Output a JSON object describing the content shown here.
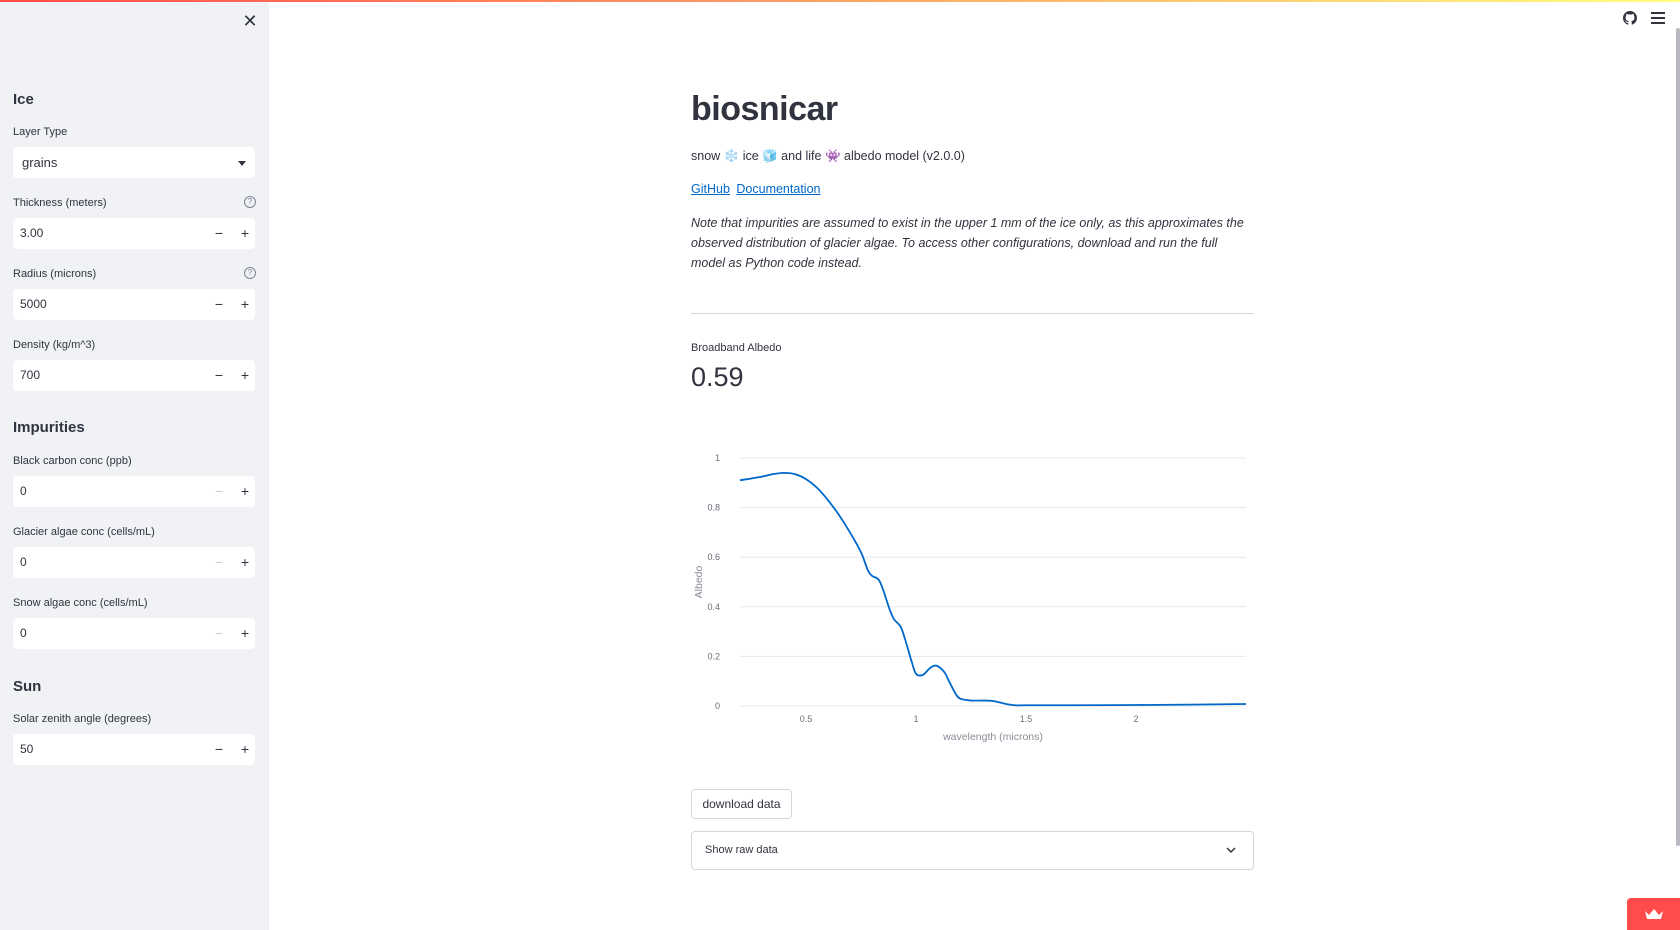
{
  "sidebar": {
    "close_icon": "close-icon",
    "ice_section": "Ice",
    "layer_type_label": "Layer Type",
    "layer_type_value": "grains",
    "thickness_label": "Thickness (meters)",
    "thickness_value": "3.00",
    "radius_label": "Radius (microns)",
    "radius_value": "5000",
    "density_label": "Density (kg/m^3)",
    "density_value": "700",
    "impurities_section": "Impurities",
    "black_carbon_label": "Black carbon conc (ppb)",
    "black_carbon_value": "0",
    "glacier_algae_label": "Glacier algae conc (cells/mL)",
    "glacier_algae_value": "0",
    "snow_algae_label": "Snow algae conc (cells/mL)",
    "snow_algae_value": "0",
    "sun_section": "Sun",
    "zenith_label": "Solar zenith angle (degrees)",
    "zenith_value": "50",
    "help_glyph": "?",
    "minus_glyph": "−",
    "plus_glyph": "+"
  },
  "header": {
    "github_icon": "github-icon",
    "menu_icon": "hamburger-menu-icon"
  },
  "main": {
    "title": "biosnicar",
    "subtitle": "snow ❄️ ice 🧊 and life 👾 albedo model (v2.0.0)",
    "link_github": "GitHub",
    "link_docs": "Documentation",
    "note": "Note that impurities are assumed to exist in the upper 1 mm of the ice only, as this approximates the observed distribution of glacier algae. To access other configurations, download and run the full model as Python code instead.",
    "metric_label": "Broadband Albedo",
    "metric_value": "0.59",
    "download_label": "download data",
    "expander_label": "Show raw data"
  },
  "chart_data": {
    "type": "line",
    "xlabel": "wavelength (microns)",
    "ylabel": "Albedo",
    "xlim": [
      0.2,
      2.5
    ],
    "ylim": [
      0,
      1
    ],
    "x_ticks": [
      0.5,
      1,
      1.5,
      2
    ],
    "x_tick_labels": [
      "0.5",
      "1",
      "1.5",
      "2"
    ],
    "y_ticks": [
      0,
      0.2,
      0.4,
      0.6,
      0.8,
      1
    ],
    "y_tick_labels": [
      "0",
      "0.2",
      "0.4",
      "0.6",
      "0.8",
      "1"
    ],
    "grid": true,
    "line_color": "#0068c9",
    "series": [
      {
        "x": [
          0.2,
          0.3,
          0.35,
          0.4,
          0.45,
          0.5,
          0.55,
          0.6,
          0.65,
          0.7,
          0.75,
          0.78,
          0.8,
          0.83,
          0.85,
          0.88,
          0.9,
          0.93,
          0.95,
          0.98,
          1.0,
          1.03,
          1.06,
          1.08,
          1.1,
          1.13,
          1.15,
          1.18,
          1.2,
          1.25,
          1.3,
          1.35,
          1.4,
          1.45,
          1.5,
          1.7,
          2.0,
          2.3,
          2.5
        ],
        "y": [
          0.91,
          0.925,
          0.935,
          0.94,
          0.935,
          0.915,
          0.88,
          0.83,
          0.77,
          0.7,
          0.62,
          0.55,
          0.525,
          0.51,
          0.47,
          0.39,
          0.35,
          0.32,
          0.27,
          0.18,
          0.13,
          0.125,
          0.15,
          0.162,
          0.16,
          0.135,
          0.1,
          0.05,
          0.03,
          0.022,
          0.022,
          0.02,
          0.01,
          0.003,
          0.003,
          0.003,
          0.004,
          0.006,
          0.008
        ]
      }
    ]
  },
  "colors": {
    "accent": "#ff4b4b",
    "link": "#0068c9",
    "sidebar_bg": "#f0f2f6"
  }
}
